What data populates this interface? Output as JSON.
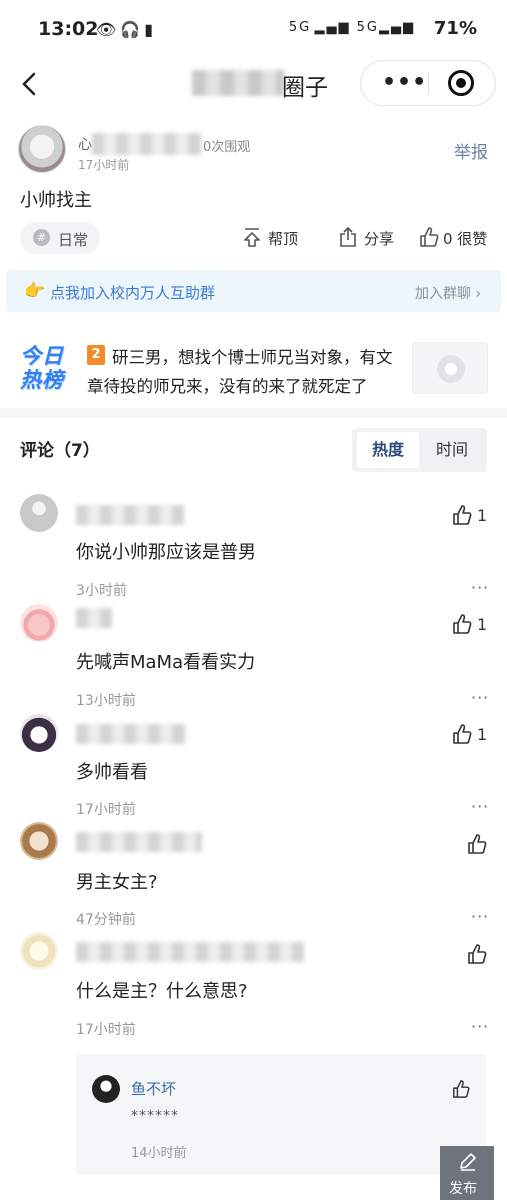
{
  "status_bar": {
    "time": "13:02",
    "left_icons": "👁🎧▮",
    "signal": "5G ▂▄▆ 5G▂▄▆",
    "battery": "71%"
  },
  "nav": {
    "title_visible": "圈子",
    "capsule_more": "•••"
  },
  "post": {
    "author_prefix": "心",
    "views": "0次围观",
    "time": "17小时前",
    "report": "举报",
    "title": "小帅找主",
    "tag": "日常",
    "tag_icon": "#",
    "actions": {
      "boost": "帮顶",
      "share": "分享",
      "like": "0 很赞"
    }
  },
  "banner": {
    "hand": "👉",
    "text": "点我加入校内万人互助群",
    "join": "加入群聊 ›"
  },
  "hot": {
    "logo_line1": "今日",
    "logo_line2": "热榜",
    "rank": "2",
    "text": "研三男，想找个博士师兄当对象，有文章待投的师兄来，没有的来了就死定了"
  },
  "comments_section": {
    "header": "评论（7）",
    "sort_hot": "热度",
    "sort_time": "时间"
  },
  "comments": [
    {
      "text": "你说小帅那应该是普男",
      "time": "3小时前",
      "likes": "1",
      "more": "···"
    },
    {
      "text": "先喊声MaMa看看实力",
      "time": "13小时前",
      "likes": "1",
      "more": "···"
    },
    {
      "text": "多帅看看",
      "time": "17小时前",
      "likes": "1",
      "more": "···"
    },
    {
      "text": "男主女主?",
      "time": "47分钟前",
      "likes": "",
      "more": "···"
    },
    {
      "text": "什么是主？什么意思?",
      "time": "17小时前",
      "likes": "",
      "more": "···"
    }
  ],
  "reply": {
    "name": "鱼不坏",
    "text": "******",
    "time": "14小时前",
    "more": "···"
  },
  "publish": {
    "label": "发布"
  },
  "colors": {
    "link_blue": "#3a7bd5",
    "report_gray_blue": "#6b82a7",
    "hot_orange": "#f58a2a"
  }
}
